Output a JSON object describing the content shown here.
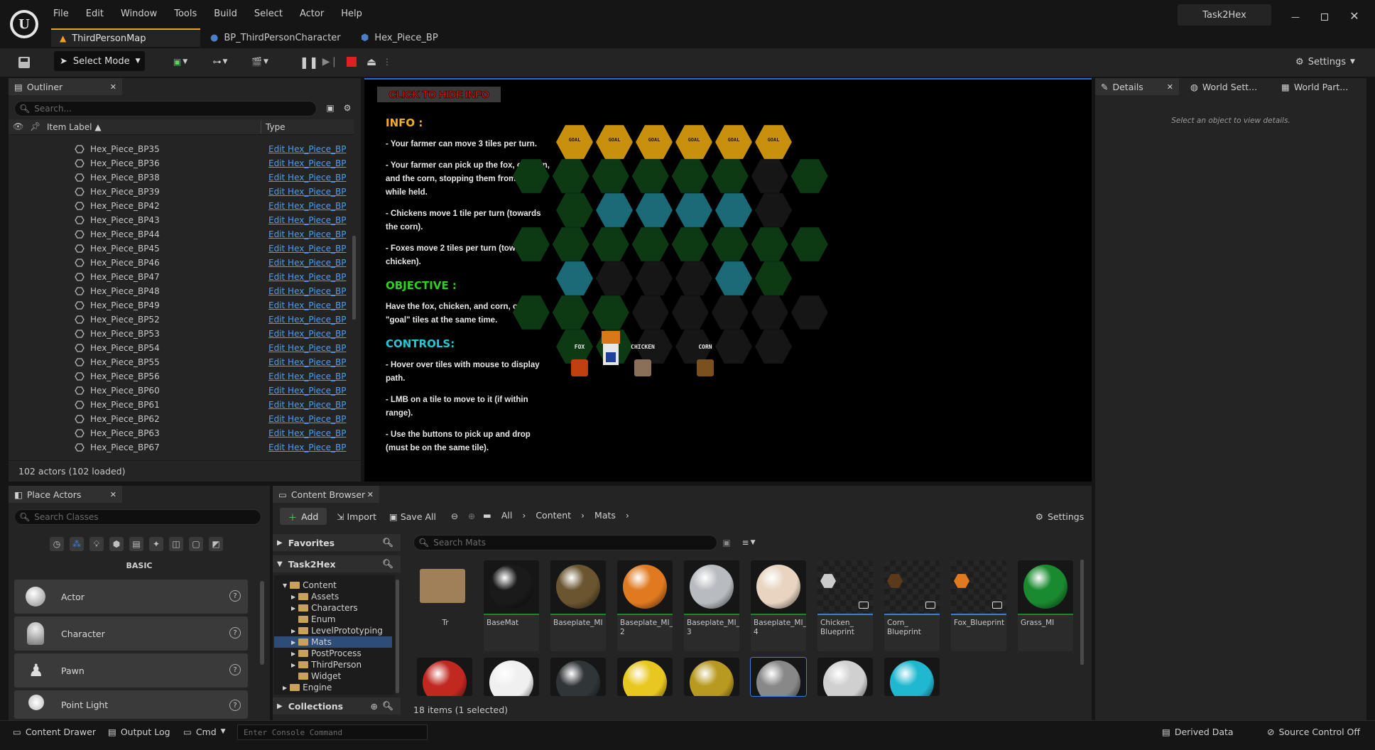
{
  "app": {
    "project": "Task2Hex",
    "menu": [
      "File",
      "Edit",
      "Window",
      "Tools",
      "Build",
      "Select",
      "Actor",
      "Help"
    ],
    "tabs": [
      "ThirdPersonMap",
      "BP_ThirdPersonCharacter",
      "Hex_Piece_BP"
    ]
  },
  "toolbar": {
    "select_mode": "Select Mode",
    "settings": "Settings"
  },
  "outliner": {
    "title": "Outliner",
    "search_placeholder": "Search...",
    "col_label": "Item Label",
    "col_type": "Type",
    "rows": [
      {
        "label": "Hex_Piece_BP35",
        "type": "Edit Hex_Piece_BP"
      },
      {
        "label": "Hex_Piece_BP36",
        "type": "Edit Hex_Piece_BP"
      },
      {
        "label": "Hex_Piece_BP38",
        "type": "Edit Hex_Piece_BP"
      },
      {
        "label": "Hex_Piece_BP39",
        "type": "Edit Hex_Piece_BP"
      },
      {
        "label": "Hex_Piece_BP42",
        "type": "Edit Hex_Piece_BP"
      },
      {
        "label": "Hex_Piece_BP43",
        "type": "Edit Hex_Piece_BP"
      },
      {
        "label": "Hex_Piece_BP44",
        "type": "Edit Hex_Piece_BP"
      },
      {
        "label": "Hex_Piece_BP45",
        "type": "Edit Hex_Piece_BP"
      },
      {
        "label": "Hex_Piece_BP46",
        "type": "Edit Hex_Piece_BP"
      },
      {
        "label": "Hex_Piece_BP47",
        "type": "Edit Hex_Piece_BP"
      },
      {
        "label": "Hex_Piece_BP48",
        "type": "Edit Hex_Piece_BP"
      },
      {
        "label": "Hex_Piece_BP49",
        "type": "Edit Hex_Piece_BP"
      },
      {
        "label": "Hex_Piece_BP52",
        "type": "Edit Hex_Piece_BP"
      },
      {
        "label": "Hex_Piece_BP53",
        "type": "Edit Hex_Piece_BP"
      },
      {
        "label": "Hex_Piece_BP54",
        "type": "Edit Hex_Piece_BP"
      },
      {
        "label": "Hex_Piece_BP55",
        "type": "Edit Hex_Piece_BP"
      },
      {
        "label": "Hex_Piece_BP56",
        "type": "Edit Hex_Piece_BP"
      },
      {
        "label": "Hex_Piece_BP60",
        "type": "Edit Hex_Piece_BP"
      },
      {
        "label": "Hex_Piece_BP61",
        "type": "Edit Hex_Piece_BP"
      },
      {
        "label": "Hex_Piece_BP62",
        "type": "Edit Hex_Piece_BP"
      },
      {
        "label": "Hex_Piece_BP63",
        "type": "Edit Hex_Piece_BP"
      },
      {
        "label": "Hex_Piece_BP67",
        "type": "Edit Hex_Piece_BP"
      }
    ],
    "footer": "102 actors (102 loaded)"
  },
  "viewport": {
    "hide_button": "CLICK TO HIDE INFO",
    "info_title": "INFO :",
    "info_lines": [
      "- Your farmer can move 3 tiles per turn.",
      "- Your farmer can pick up the fox, chicken, and the corn, stopping them from moving while held.",
      "- Chickens move 1 tile per turn (towards the corn).",
      "- Foxes move 2 tiles per turn (towards the chicken)."
    ],
    "objective_title": "OBJECTIVE :",
    "objective_text": "Have the fox, chicken, and corn, on the \"goal\" tiles at the same time.",
    "controls_title": "CONTROLS:",
    "controls_lines": [
      "- Hover over tiles with mouse to display path.",
      "- LMB on a tile to move to it (if within range).",
      "- Use the buttons to pick up and drop (must be on the same tile)."
    ],
    "goal_label": "GOAL",
    "start_label": "START",
    "fox_label": "FOX",
    "chicken_label": "CHICKEN",
    "corn_label": "CORN"
  },
  "details": {
    "tabs": [
      "Details",
      "World Sett...",
      "World Part..."
    ],
    "empty_text": "Select an object to view details."
  },
  "place_actors": {
    "title": "Place Actors",
    "search_placeholder": "Search Classes",
    "category": "BASIC",
    "items": [
      "Actor",
      "Character",
      "Pawn",
      "Point Light"
    ]
  },
  "content_browser": {
    "title": "Content Browser",
    "add": "Add",
    "import": "Import",
    "save_all": "Save All",
    "path": [
      "All",
      "Content",
      "Mats"
    ],
    "settings": "Settings",
    "favorites": "Favorites",
    "project": "Task2Hex",
    "collections": "Collections",
    "tree": [
      "Content",
      "Assets",
      "Characters",
      "Enum",
      "LevelPrototyping",
      "Mats",
      "PostProcess",
      "ThirdPerson",
      "Widget",
      "Engine"
    ],
    "search_placeholder": "Search Mats",
    "assets": [
      {
        "name": "Tr",
        "color": "#a08058"
      },
      {
        "name": "BaseMat",
        "color": "#1a1a1a"
      },
      {
        "name": "Baseplate_MI",
        "color": "#6a5530"
      },
      {
        "name": "Baseplate_MI_ 2",
        "color": "#e07a20"
      },
      {
        "name": "Baseplate_MI_ 3",
        "color": "#b8bcc0"
      },
      {
        "name": "Baseplate_MI_ 4",
        "color": "#e8d4c0"
      },
      {
        "name": "Chicken_ Blueprint",
        "color": "#cccccc"
      },
      {
        "name": "Corn_ Blueprint",
        "color": "#5a3a1a"
      },
      {
        "name": "Fox_Blueprint",
        "color": "#e07a20"
      },
      {
        "name": "Grass_MI",
        "color": "#1a8a30"
      }
    ],
    "row2_colors": [
      "#c02820",
      "#f0f0f0",
      "#303538",
      "#e8c820",
      "#b89a20",
      "#888888",
      "#d0d0d0",
      "#20b8d0"
    ],
    "status": "18 items (1 selected)"
  },
  "status_bar": {
    "content_drawer": "Content Drawer",
    "output_log": "Output Log",
    "cmd": "Cmd",
    "console_placeholder": "Enter Console Command",
    "derived_data": "Derived Data",
    "source_control": "Source Control Off"
  }
}
